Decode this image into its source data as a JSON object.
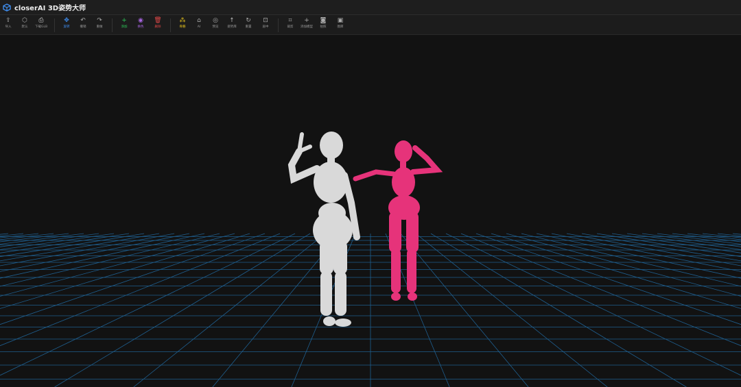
{
  "app": {
    "title": "closerAI 3D姿势大师"
  },
  "toolbar": {
    "tools": [
      {
        "label": "导入",
        "icon": "upload-icon",
        "glyph": "⇪",
        "color": "#aaaaaa"
      },
      {
        "label": "默认",
        "icon": "cube-icon",
        "glyph": "⬡",
        "color": "#aaaaaa"
      },
      {
        "label": "下载GLB",
        "icon": "download-file-icon",
        "glyph": "⎙",
        "color": "#cccccc"
      },
      {
        "label": "旋转",
        "icon": "rotate-icon",
        "glyph": "✥",
        "color": "#3f8ef0"
      },
      {
        "label": "撤销",
        "icon": "undo-icon",
        "glyph": "↶",
        "color": "#aaaaaa"
      },
      {
        "label": "重做",
        "icon": "redo-icon",
        "glyph": "↷",
        "color": "#aaaaaa"
      },
      {
        "label": "添加",
        "icon": "plus-icon",
        "glyph": "+",
        "color": "#2ecc5a"
      },
      {
        "label": "换色",
        "icon": "palette-icon",
        "glyph": "◉",
        "color": "#a765e0"
      },
      {
        "label": "删除",
        "icon": "trash-icon",
        "glyph": "🗑",
        "color": "#e04848"
      },
      {
        "label": "骨骼",
        "icon": "bones-icon",
        "glyph": "⁂",
        "color": "#e6c21c"
      },
      {
        "label": "AI",
        "icon": "robot-icon",
        "glyph": "⌂",
        "color": "#aaaaaa"
      },
      {
        "label": "预览",
        "icon": "eye-icon",
        "glyph": "◎",
        "color": "#aaaaaa"
      },
      {
        "label": "姿势库",
        "icon": "figure-icon",
        "glyph": "☨",
        "color": "#aaaaaa"
      },
      {
        "label": "重置",
        "icon": "reset-icon",
        "glyph": "↻",
        "color": "#aaaaaa"
      },
      {
        "label": "居中",
        "icon": "focus-icon",
        "glyph": "⊡",
        "color": "#aaaaaa"
      },
      {
        "label": "裁剪",
        "icon": "crop-icon",
        "glyph": "⌗",
        "color": "#aaaaaa"
      },
      {
        "label": "添加模型",
        "icon": "add-model-icon",
        "glyph": "+",
        "color": "#aaaaaa"
      },
      {
        "label": "拍照",
        "icon": "camera-icon",
        "glyph": "◙",
        "color": "#aaaaaa"
      },
      {
        "label": "图库",
        "icon": "gallery-icon",
        "glyph": "▣",
        "color": "#aaaaaa"
      }
    ]
  },
  "scene": {
    "grid_color": "#1f5f8f",
    "figure_left_color": "#d9d9d9",
    "figure_right_color": "#e6337a"
  }
}
